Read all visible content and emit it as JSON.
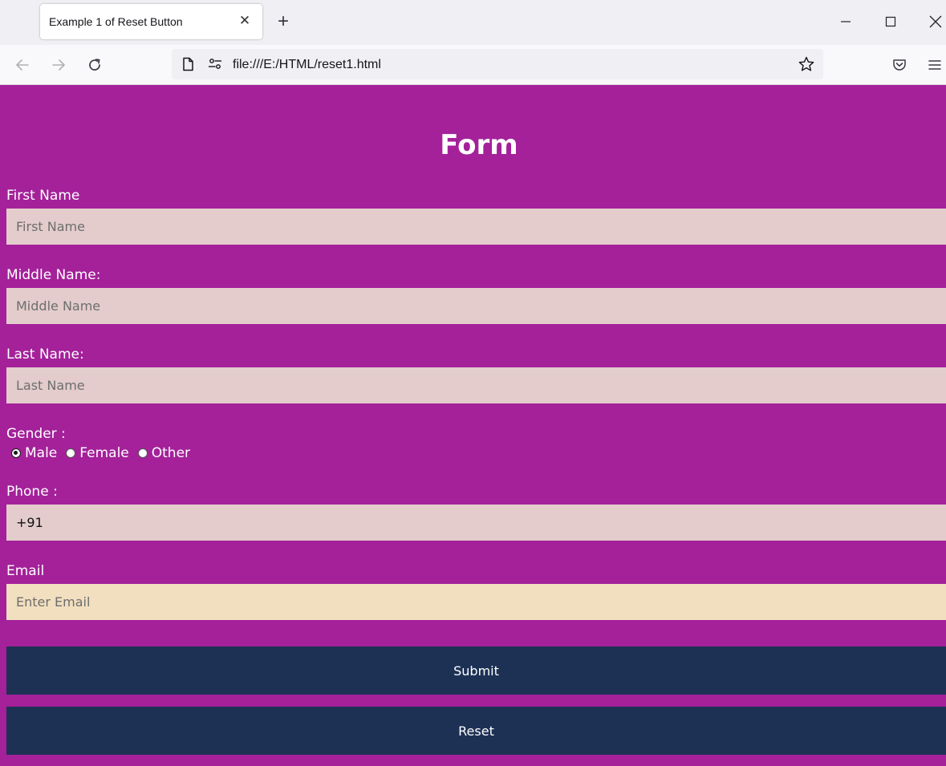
{
  "browser": {
    "tab_title": "Example 1 of Reset Button",
    "tab_close": "✕",
    "new_tab": "+",
    "url": "file:///E:/HTML/reset1.html"
  },
  "form": {
    "title": "Form",
    "first_name": {
      "label": "First Name",
      "placeholder": "First Name",
      "value": ""
    },
    "middle_name": {
      "label": "Middle Name:",
      "placeholder": "Middle Name",
      "value": ""
    },
    "last_name": {
      "label": "Last Name:",
      "placeholder": "Last Name",
      "value": ""
    },
    "gender": {
      "label": "Gender :",
      "options": [
        "Male",
        "Female",
        "Other"
      ],
      "selected": "Male"
    },
    "phone": {
      "label": "Phone :",
      "value": "+91"
    },
    "email": {
      "label": "Email",
      "placeholder": "Enter Email",
      "value": ""
    },
    "submit_label": "Submit",
    "reset_label": "Reset"
  },
  "colors": {
    "page_background": "#a4219a",
    "input_background": "#e4cccc",
    "focused_input_background": "#f1dfbf",
    "button_background": "#1d3155",
    "text": "#ffffff"
  }
}
